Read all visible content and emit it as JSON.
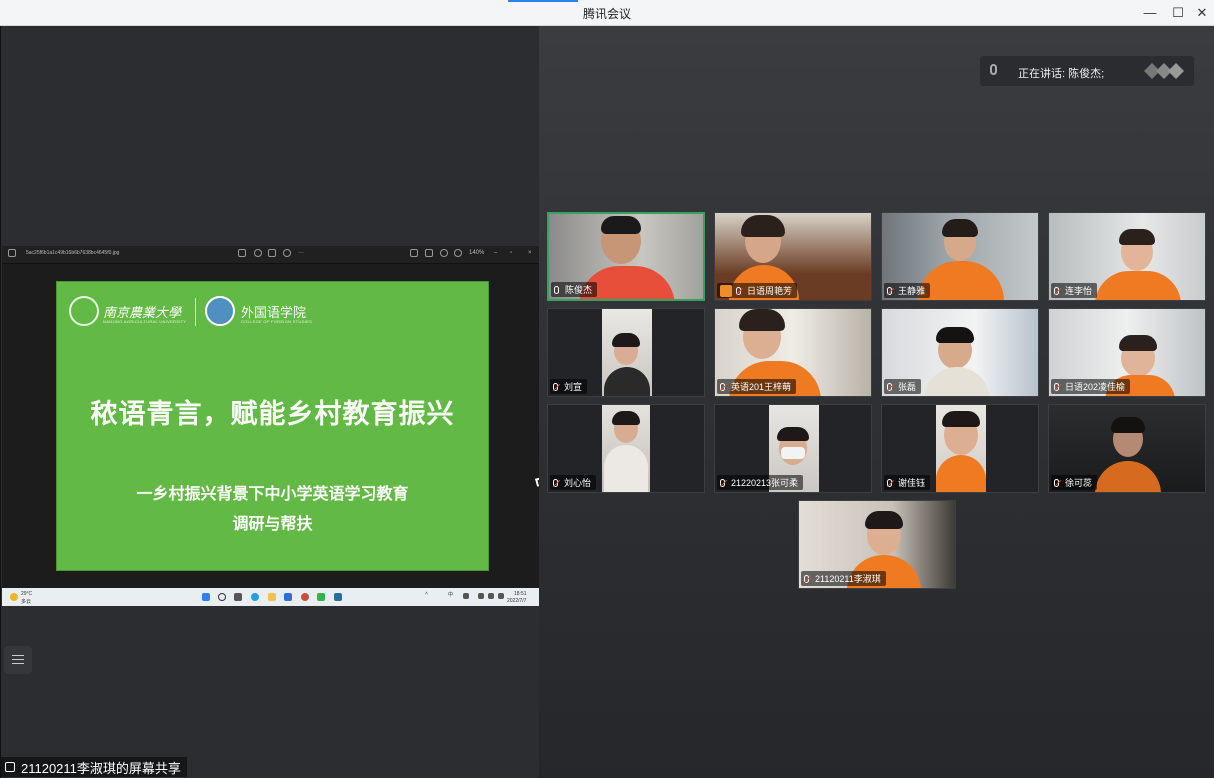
{
  "window": {
    "title": "腾讯会议",
    "minimize_glyph": "—",
    "maximize_glyph": "☐",
    "close_glyph": "✕"
  },
  "viewer": {
    "filename": "5ac25f6b1a1c49b16b6b7638bc4645f0.jpg",
    "zoom": "140%"
  },
  "slide": {
    "university_cn": "南京農業大學",
    "university_en": "NANJING AGRICULTURAL UNIVERSITY",
    "college_cn": "外国语学院",
    "college_en": "COLLEGE OF FOREIGN STUDIES",
    "title": "秾语青言，赋能乡村教育振兴",
    "subtitle_line1": "一乡村振兴背景下中小学英语学习教育",
    "subtitle_line2": "调研与帮扶"
  },
  "taskbar": {
    "weather_temp": "29°C",
    "weather_desc": "多云",
    "tray_lang": "中",
    "time": "18:51",
    "date": "2022/7/7"
  },
  "share_label": "21120211李淑琪的屏幕共享",
  "speaking_banner": "正在讲话: 陈俊杰;",
  "participants": [
    {
      "name": "陈俊杰"
    },
    {
      "name": "日语周艳芳"
    },
    {
      "name": "王静雅"
    },
    {
      "name": "连李怡"
    },
    {
      "name": "刘宣"
    },
    {
      "name": "英语201王梓萌"
    },
    {
      "name": "张磊"
    },
    {
      "name": "日语202凌佳榆"
    },
    {
      "name": "刘心怡"
    },
    {
      "name": "21220213张可柔"
    },
    {
      "name": "谢佳钰"
    },
    {
      "name": "徐可蕊"
    },
    {
      "name": "21120211李淑琪"
    }
  ],
  "colors": {
    "slide_green": "#63b946",
    "active_border": "#3aa05f",
    "shirt_orange": "#f07a22",
    "muted_red": "#e64c3c"
  }
}
